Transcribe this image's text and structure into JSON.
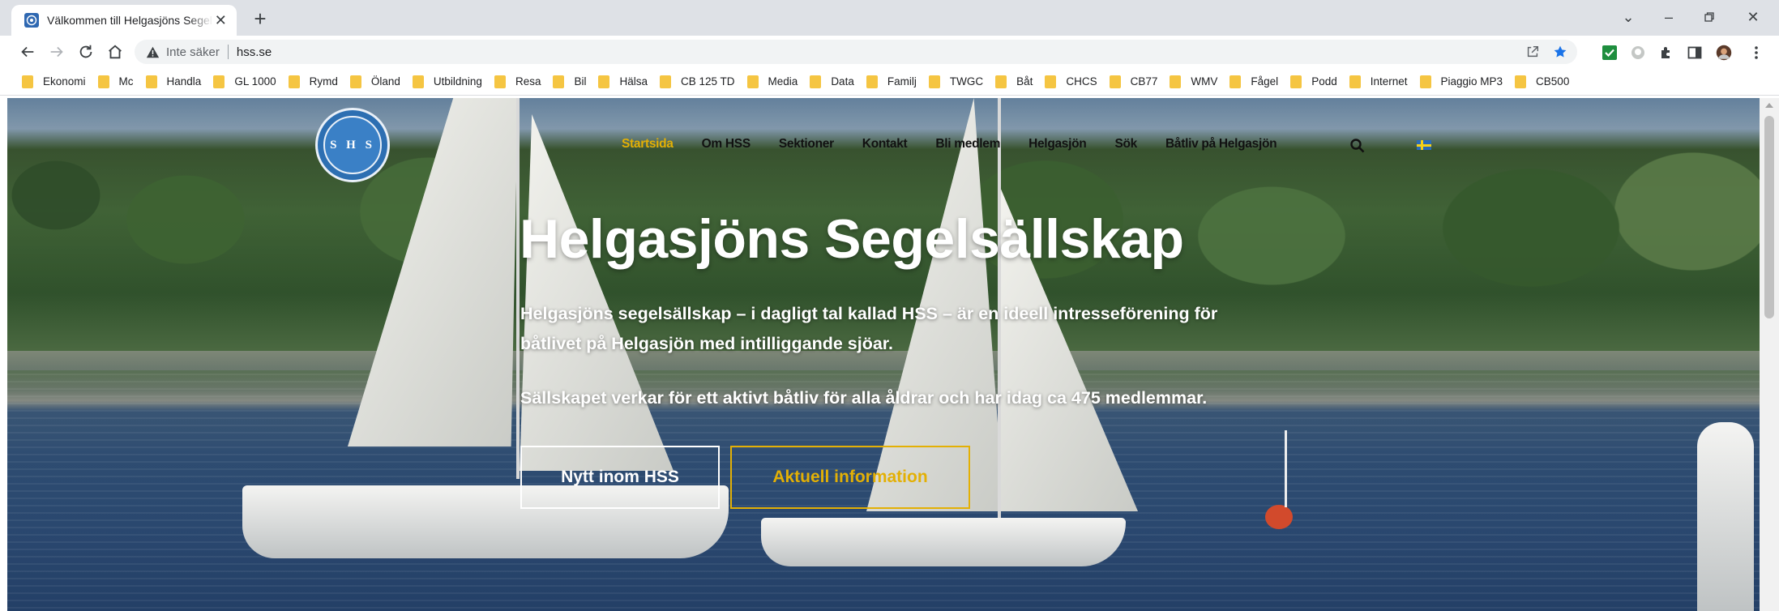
{
  "browser": {
    "tab": {
      "title": "Välkommen till Helgasjöns Segelsällskap"
    },
    "address": {
      "security_label": "Inte säker",
      "url": "hss.se"
    },
    "bookmarks": [
      "Ekonomi",
      "Mc",
      "Handla",
      "GL 1000",
      "Rymd",
      "Öland",
      "Utbildning",
      "Resa",
      "Bil",
      "Hälsa",
      "CB 125 TD",
      "Media",
      "Data",
      "Familj",
      "TWGC",
      "Båt",
      "CHCS",
      "CB77",
      "WMV",
      "Fågel",
      "Podd",
      "Internet",
      "Piaggio MP3",
      "CB500"
    ]
  },
  "site": {
    "logo_text": "S H S",
    "nav": [
      "Startsida",
      "Om HSS",
      "Sektioner",
      "Kontakt",
      "Bli medlem",
      "Helgasjön",
      "Sök",
      "Båtliv på Helgasjön"
    ],
    "active_nav": "Startsida",
    "hero": {
      "title": "Helgasjöns Segelsällskap",
      "paragraph1": "Helgasjöns segelsällskap – i dagligt tal kallad HSS – är en ideell intresseförening för båtlivet på Helgasjön med intilliggande sjöar.",
      "paragraph2": "Sällskapet verkar för ett aktivt båtliv för alla åldrar och har idag ca 475 medlemmar.",
      "button_news": "Nytt inom HSS",
      "button_info": "Aktuell information"
    },
    "colors": {
      "accent": "#e3b005",
      "logo_blue": "#2d6fb2"
    }
  }
}
